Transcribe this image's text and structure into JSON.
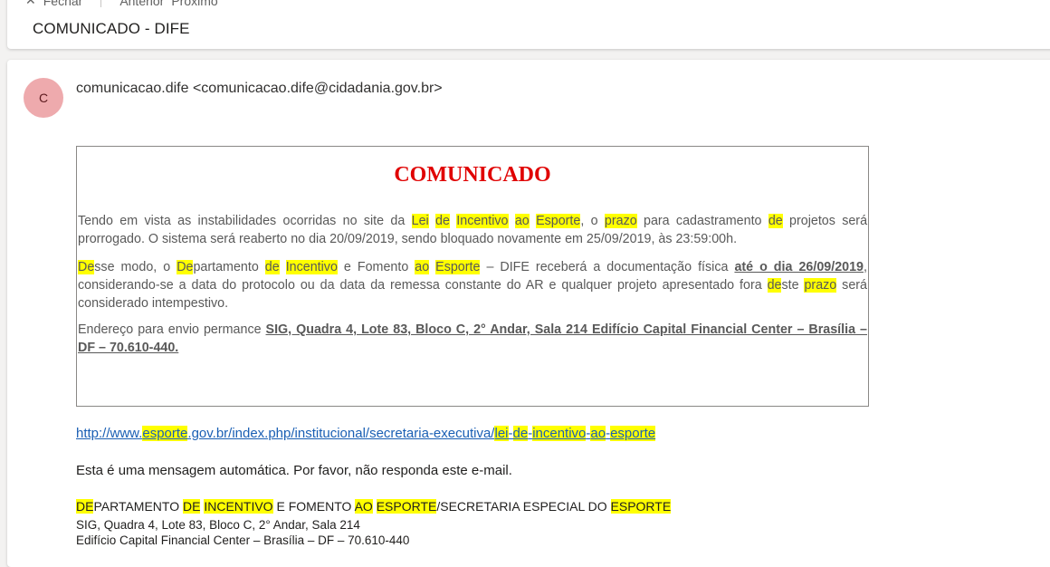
{
  "toolbar": {
    "close_label": "Fechar",
    "previous_label": "Anterior",
    "next_label": "Próximo"
  },
  "subject": "COMUNICADO - DIFE",
  "sender": {
    "initial": "C",
    "display": "comunicacao.dife <comunicacao.dife@cidadania.gov.br>"
  },
  "notice": {
    "title": "COMUNICADO",
    "p1_a": "Tendo em vista as instabilidades ocorridas no site da ",
    "p1_lei": "Lei",
    "p1_de": "de",
    "p1_incentivo": "Incentivo",
    "p1_ao": "ao",
    "p1_esporte": "Esporte",
    "p1_b": ", o ",
    "p1_prazo": "prazo",
    "p1_c": " para cadastramento ",
    "p1_de2": "de",
    "p1_d": " projetos será prorrogado. O sistema será reaberto no dia 20/09/2019, sendo bloquado novamente em 25/09/2019, às 23:59:00h.",
    "p2_de": "De",
    "p2_a": "sse modo, o ",
    "p2_de2": "De",
    "p2_b": "partamento ",
    "p2_de3": "de",
    "p2_incentivo": "Incentivo",
    "p2_c": " e Fomento ",
    "p2_ao": "ao",
    "p2_esporte": "Esporte",
    "p2_d": " – DIFE receberá a documentação física ",
    "p2_date": "até o dia 26/09/2019",
    "p2_e": ", considerando-se a data do protocolo ou da data da remessa constante do AR e qualquer projeto apresentado fora ",
    "p2_de4": "de",
    "p2_f": "ste ",
    "p2_prazo": "prazo",
    "p2_g": " será considerado intempestivo.",
    "p3_a": "Endereço para envio permance ",
    "p3_addr": "SIG, Quadra 4, Lote 83, Bloco C, 2° Andar, Sala 214 Edifício Capital Financial Center – Brasília – DF – 70.610-440."
  },
  "link": {
    "a": "http://www.",
    "esporte": "esporte",
    "b": ".gov.br/index.php/institucional/secretaria-executiva/",
    "lei": "lei",
    "d1": "-",
    "de": "de",
    "d2": "-",
    "incentivo": "incentivo",
    "d3": "-",
    "ao": "ao",
    "d4": "-",
    "esporte2": "esporte"
  },
  "auto_message": "Esta é uma mensagem automática. Por favor, não responda este e-mail.",
  "signature": {
    "de": "DE",
    "a": "PARTAMENTO ",
    "de2": "DE",
    "incentivo": "INCENTIVO",
    "b": " E FOMENTO ",
    "ao": "AO",
    "esporte": "ESPORTE",
    "c": "/SECRETARIA ESPECIAL DO ",
    "esporte2": "ESPORTE",
    "address1": "SIG, Quadra 4, Lote 83, Bloco C, 2° Andar, Sala 214",
    "address2": "Edifício Capital Financial Center – Brasília – DF – 70.610-440"
  }
}
